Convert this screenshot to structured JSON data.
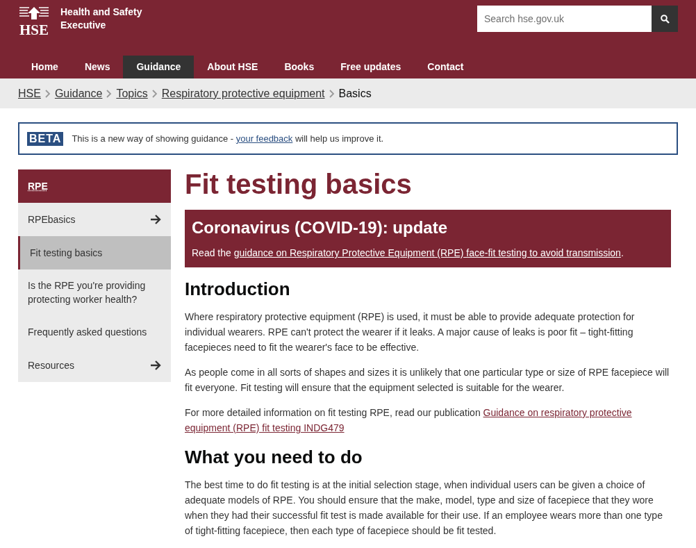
{
  "header": {
    "logo_text": "HSE",
    "org_name": "Health and Safety Executive",
    "search": {
      "placeholder": "Search hse.gov.uk"
    }
  },
  "nav": [
    {
      "label": "Home",
      "selected": false
    },
    {
      "label": "News",
      "selected": false
    },
    {
      "label": "Guidance",
      "selected": true
    },
    {
      "label": "About HSE",
      "selected": false
    },
    {
      "label": "Books",
      "selected": false
    },
    {
      "label": "Free updates",
      "selected": false
    },
    {
      "label": "Contact",
      "selected": false
    }
  ],
  "breadcrumb": [
    {
      "label": "HSE",
      "link": true
    },
    {
      "label": "Guidance",
      "link": true
    },
    {
      "label": "Topics",
      "link": true
    },
    {
      "label": "Respiratory protective equipment",
      "link": true
    },
    {
      "label": "Basics",
      "link": false
    }
  ],
  "beta": {
    "tag": "BETA",
    "before": "This is a new way of showing guidance - ",
    "link": "your feedback",
    "after": " will help us improve it."
  },
  "sidebar": {
    "heading": "RPE",
    "items": [
      {
        "label": "RPEbasics",
        "selected": false,
        "arrow": true
      },
      {
        "label": "Fit testing basics",
        "selected": true,
        "arrow": false
      },
      {
        "label": "Is the RPE you're providing protecting worker health?",
        "selected": false,
        "arrow": false
      },
      {
        "label": "Frequently asked questions",
        "selected": false,
        "arrow": false
      },
      {
        "label": "Resources",
        "selected": false,
        "arrow": true
      }
    ]
  },
  "page_title": "Fit testing basics",
  "notice": {
    "title": "Coronavirus (COVID-19): update",
    "before": "Read the ",
    "link": "guidance on Respiratory Protective Equipment (RPE) face-fit testing to avoid transmission",
    "after": "."
  },
  "sections": [
    {
      "heading": "Introduction",
      "paragraphs": [
        {
          "before": "Where respiratory protective equipment (RPE) is used, it must be able to provide adequate protection for individual wearers. RPE can't protect the wearer if it leaks. A major cause of leaks is poor fit – tight-fitting facepieces need to fit the wearer's face to be effective."
        },
        {
          "before": "As people come in all sorts of shapes and sizes it is unlikely that one particular type or size of RPE facepiece will fit everyone. Fit testing will ensure that the equipment selected is suitable for the wearer."
        },
        {
          "before": "For more detailed information on fit testing RPE, read our publication ",
          "link_lines": [
            "Guidance on respiratory protective",
            "equipment (RPE) fit testing INDG479"
          ]
        }
      ]
    },
    {
      "heading": "What you need to do",
      "paragraphs": [
        {
          "before": "The best time to do fit testing is at the initial selection stage, when individual users can be given a choice of adequate models of RPE. You should ensure that the make, model, type and size of facepiece that they wore when they had their successful fit test is made available for their use. If an employee wears more than one type of tight-fitting facepiece, then each type of facepiece should be fit tested."
        }
      ]
    }
  ]
}
